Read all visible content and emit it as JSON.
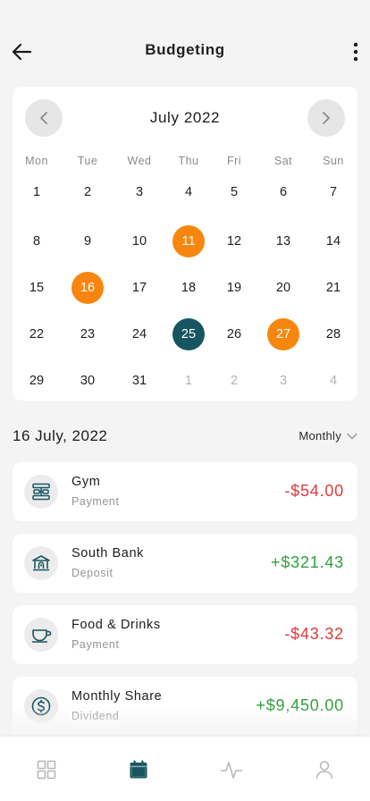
{
  "header": {
    "title": "Budgeting",
    "back_icon": "arrow-left-icon",
    "more_icon": "more-vertical-icon"
  },
  "calendar": {
    "month_label": "July 2022",
    "weekdays": [
      "Mon",
      "Tue",
      "Wed",
      "Thu",
      "Fri",
      "Sat",
      "Sun"
    ],
    "weeks": [
      [
        "1",
        "2",
        "3",
        "4",
        "5",
        "6",
        "7"
      ],
      [
        "8",
        "9",
        "10",
        "11",
        "12",
        "13",
        "14"
      ],
      [
        "15",
        "16",
        "17",
        "18",
        "19",
        "20",
        "21"
      ],
      [
        "22",
        "23",
        "24",
        "25",
        "26",
        "27",
        "28"
      ],
      [
        "29",
        "30",
        "31",
        "1",
        "2",
        "3",
        "4"
      ]
    ],
    "muted_next_month": [
      "1",
      "2",
      "3",
      "4"
    ],
    "orange_days": [
      "11",
      "16",
      "27"
    ],
    "selected_day": "25",
    "colors": {
      "orange": "#f7860f",
      "teal": "#175660"
    }
  },
  "selection": {
    "date_label": "16 July, 2022",
    "period": "Monthly"
  },
  "transactions": [
    {
      "name": "Gym",
      "type": "Payment",
      "amount": "-$54.00",
      "icon": "dumbbell-icon",
      "sign": "negative"
    },
    {
      "name": "South Bank",
      "type": "Deposit",
      "amount": "+$321.43",
      "icon": "bank-icon",
      "sign": "positive"
    },
    {
      "name": "Food & Drinks",
      "type": "Payment",
      "amount": "-$43.32",
      "icon": "coffee-cup-icon",
      "sign": "negative"
    },
    {
      "name": "Monthly Share",
      "type": "Dividend",
      "amount": "+$9,450.00",
      "icon": "dollar-circle-icon",
      "sign": "positive"
    }
  ],
  "tabbar": [
    {
      "name": "dashboard",
      "icon": "grid-icon",
      "active": false
    },
    {
      "name": "calendar",
      "icon": "calendar-icon",
      "active": true
    },
    {
      "name": "activity",
      "icon": "activity-icon",
      "active": false
    },
    {
      "name": "profile",
      "icon": "user-icon",
      "active": false
    }
  ],
  "colors": {
    "accent": "#175660",
    "negative": "#de3a3a",
    "positive": "#2fa13c",
    "inactive": "#b5b5b5"
  }
}
